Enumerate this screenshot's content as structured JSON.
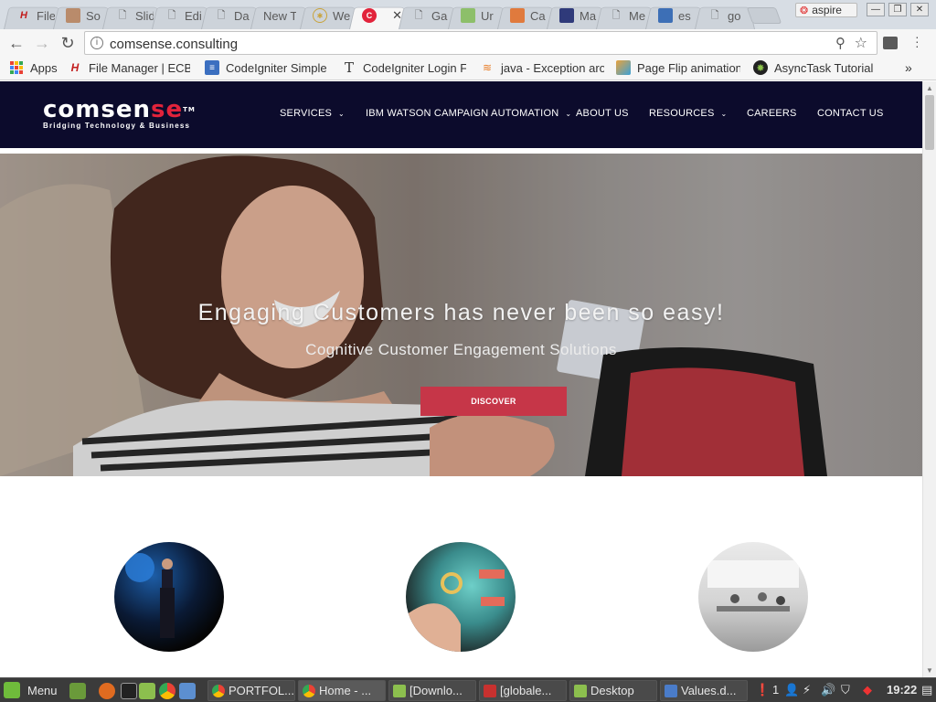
{
  "browser": {
    "tabs": [
      {
        "title": "File",
        "icon": "hashtag-icon",
        "active": false
      },
      {
        "title": "So",
        "icon": "image-icon",
        "active": false
      },
      {
        "title": "Slid",
        "icon": "page-icon",
        "active": false
      },
      {
        "title": "Edi",
        "icon": "page-icon",
        "active": false
      },
      {
        "title": "Da",
        "icon": "page-icon",
        "active": false
      },
      {
        "title": "New T",
        "icon": "",
        "active": false
      },
      {
        "title": "We",
        "icon": "circle-icon",
        "active": false
      },
      {
        "title": "",
        "icon": "comsense-icon",
        "active": true
      },
      {
        "title": "Ga",
        "icon": "page-icon",
        "active": false
      },
      {
        "title": "Ur",
        "icon": "image-icon",
        "active": false
      },
      {
        "title": "Ca",
        "icon": "image-icon",
        "active": false
      },
      {
        "title": "Ma",
        "icon": "image-icon",
        "active": false
      },
      {
        "title": "Me",
        "icon": "page-icon",
        "active": false
      },
      {
        "title": "es",
        "icon": "square-icon",
        "active": false
      },
      {
        "title": "go",
        "icon": "page-icon",
        "active": false
      }
    ],
    "profile_name": "aspire",
    "url": "comsense.consulting",
    "bookmarks": [
      {
        "label": "Apps",
        "icon": "apps-icon"
      },
      {
        "label": "File Manager | ECB",
        "icon": "hashtag-icon"
      },
      {
        "label": "CodeIgniter Simple",
        "icon": "document-icon"
      },
      {
        "label": "CodeIgniter Login Fo",
        "icon": "text-icon"
      },
      {
        "label": "java - Exception aro",
        "icon": "stack-icon"
      },
      {
        "label": "Page Flip animation",
        "icon": "image-icon"
      },
      {
        "label": "AsyncTask Tutorial",
        "icon": "android-icon"
      }
    ]
  },
  "site": {
    "logo_prefix": "comse",
    "logo_mid": "n",
    "logo_suffix": "se",
    "logo_tm": "TM",
    "tagline": "Bridging Technology & Business",
    "nav": [
      {
        "label": "SERVICES",
        "dropdown": true
      },
      {
        "label": "IBM WATSON CAMPAIGN AUTOMATION",
        "dropdown": true
      },
      {
        "label": "ABOUT US",
        "dropdown": false
      },
      {
        "label": "RESOURCES",
        "dropdown": true
      },
      {
        "label": "CAREERS",
        "dropdown": false
      },
      {
        "label": "CONTACT US",
        "dropdown": false
      }
    ],
    "hero": {
      "headline": "Engaging Customers has never been so easy!",
      "subheadline": "Cognitive Customer Engagement Solutions",
      "cta": "DISCOVER"
    }
  },
  "taskbar": {
    "menu_label": "Menu",
    "tasks": [
      {
        "label": "PORTFOL...",
        "icon": "chrome-icon"
      },
      {
        "label": "Home - ...",
        "icon": "chrome-icon"
      },
      {
        "label": "[Downlo...",
        "icon": "folder-icon"
      },
      {
        "label": "[globale...",
        "icon": "filezilla-icon"
      },
      {
        "label": "Desktop",
        "icon": "folder-icon"
      },
      {
        "label": "Values.d...",
        "icon": "document-icon"
      }
    ],
    "notification_count": "1",
    "clock": "19:22"
  }
}
